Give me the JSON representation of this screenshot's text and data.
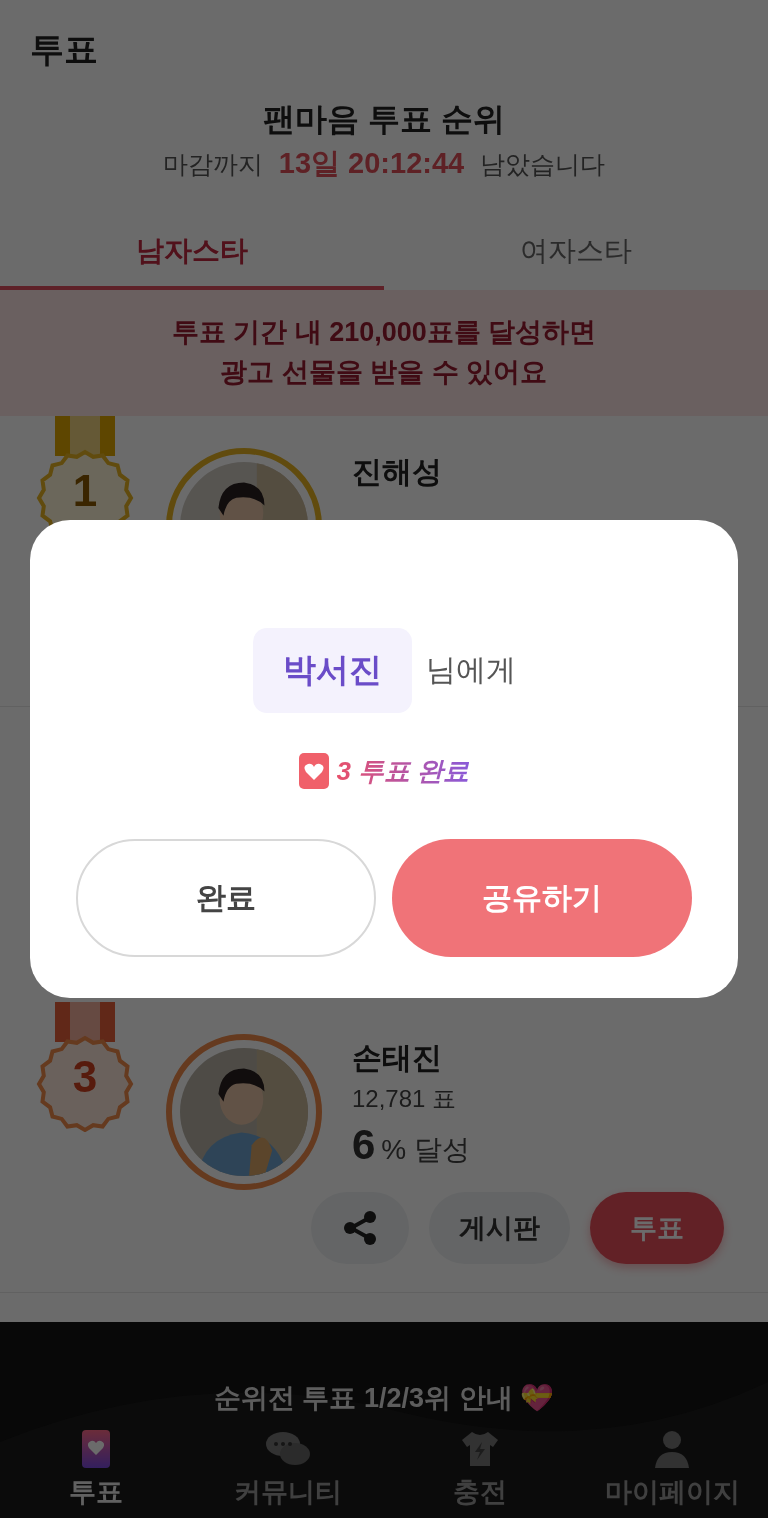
{
  "header": {
    "title": "투표"
  },
  "ranking": {
    "title": "팬마음 투표 순위",
    "countdown": {
      "prefix": "마감까지",
      "time": "13일 20:12:44",
      "suffix": "남았습니다"
    }
  },
  "tabs": [
    {
      "label": "남자스타",
      "selected": true
    },
    {
      "label": "여자스타",
      "selected": false
    }
  ],
  "notice": "투표 기간 내 210,000표를 달성하면\n광고 선물을 받을 수 있어요",
  "rows": [
    {
      "rank": "1",
      "name": "진해성"
    },
    {
      "rank": "3",
      "name": "손태진",
      "votes": "12,781 표",
      "percent": "6",
      "percent_suffix": "% 달성",
      "actions": [
        {
          "kind": "share"
        },
        {
          "kind": "board",
          "label": "게시판"
        },
        {
          "kind": "vote",
          "label": "투표"
        }
      ]
    }
  ],
  "banner": {
    "title": "순위전 투표 1/2/3위 안내 💝"
  },
  "nav": [
    {
      "label": "투표",
      "kind": "vote",
      "selected": true
    },
    {
      "label": "커뮤니티",
      "kind": "chat",
      "selected": false
    },
    {
      "label": "충전",
      "kind": "charge",
      "selected": false
    },
    {
      "label": "마이페이지",
      "kind": "person",
      "selected": false
    }
  ],
  "modal": {
    "recipient": "박서진",
    "recipient_suffix": "님에게",
    "result": "3 투표 완료",
    "buttons": [
      {
        "label": "완료",
        "kind": "secondary"
      },
      {
        "label": "공유하기",
        "kind": "primary"
      }
    ]
  }
}
